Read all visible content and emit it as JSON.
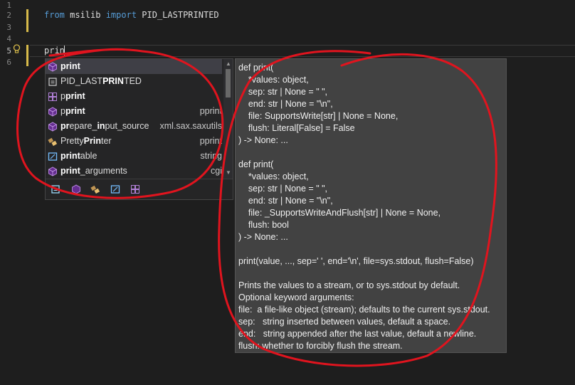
{
  "editor": {
    "line_numbers": [
      "1",
      "2",
      "3",
      "4",
      "5",
      "6"
    ],
    "line1": {
      "kw_from": "from",
      "module": " msilib ",
      "kw_import": "import",
      "name": " PID_LASTPRINTED"
    },
    "typed": "prin"
  },
  "completion": {
    "items": [
      {
        "icon": "cube-icon",
        "pre": "",
        "match": "print",
        "post": "",
        "source": "",
        "selected": true
      },
      {
        "icon": "constant-icon",
        "pre": "PID_LAST",
        "match": "PRIN",
        "post": "TED",
        "source": ""
      },
      {
        "icon": "module-icon",
        "pre": "p",
        "match": "print",
        "post": "",
        "source": ""
      },
      {
        "icon": "cube-icon",
        "pre": "p",
        "match": "print",
        "post": "",
        "source": "pprint"
      },
      {
        "icon": "cube-icon",
        "pre": "",
        "match": "pr",
        "post": "epare_",
        "match2": "in",
        "post2": "put_source",
        "source": "xml.sax.saxutils"
      },
      {
        "icon": "class-icon",
        "pre": "Pretty",
        "match": "Prin",
        "post": "ter",
        "source": "pprint"
      },
      {
        "icon": "namespace-icon",
        "pre": "",
        "match": "print",
        "post": "able",
        "source": "string"
      },
      {
        "icon": "cube-icon",
        "pre": "",
        "match": "print",
        "post": "_arguments",
        "source": "cgi"
      }
    ],
    "filters": [
      "constant-filter-icon",
      "method-filter-icon",
      "class-filter-icon",
      "namespace-filter-icon",
      "module-filter-icon"
    ]
  },
  "tooltip": {
    "lines": [
      "def print(",
      "    *values: object,",
      "    sep: str | None = \" \",",
      "    end: str | None = \"\\n\",",
      "    file: SupportsWrite[str] | None = None,",
      "    flush: Literal[False] = False",
      ") -> None: ...",
      "",
      "def print(",
      "    *values: object,",
      "    sep: str | None = \" \",",
      "    end: str | None = \"\\n\",",
      "    file: _SupportsWriteAndFlush[str] | None = None,",
      "    flush: bool",
      ") -> None: ...",
      "",
      "print(value, ..., sep=' ', end='\\n', file=sys.stdout, flush=False)",
      "",
      "Prints the values to a stream, or to sys.stdout by default.",
      "Optional keyword arguments:",
      "file:  a file-like object (stream); defaults to the current sys.stdout.",
      "sep:   string inserted between values, default a space.",
      "end:   string appended after the last value, default a newline.",
      "flush: whether to forcibly flush the stream."
    ]
  },
  "colors": {
    "background": "#1e1e1e",
    "keyword": "#569cd6",
    "annotation": "#e0141e",
    "change_bar": "#d7ba4a"
  }
}
